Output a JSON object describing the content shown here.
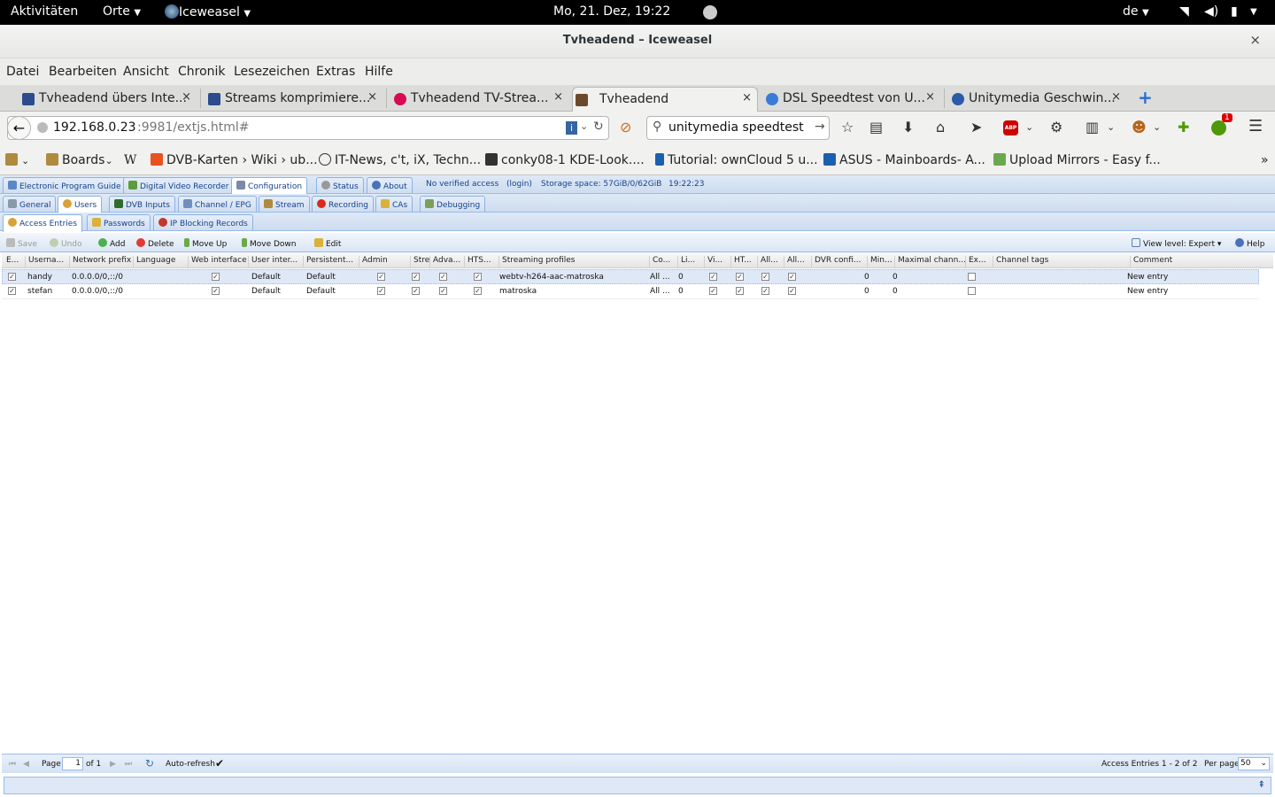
{
  "topbar": {
    "activities": "Aktivitäten",
    "places": "Orte",
    "app": "Iceweasel",
    "clock": "Mo, 21. Dez, 19:22",
    "lang": "de"
  },
  "window": {
    "title": "Tvheadend – Iceweasel",
    "close": "×"
  },
  "menu": [
    "Datei",
    "Bearbeiten",
    "Ansicht",
    "Chronik",
    "Lesezeichen",
    "Extras",
    "Hilfe"
  ],
  "tabs": [
    {
      "label": "Tvheadend übers Inte...",
      "color": "#2b4b8c"
    },
    {
      "label": "Streams komprimiere...",
      "color": "#2b4b8c"
    },
    {
      "label": "Tvheadend TV-Strea...",
      "color": "#d70a53"
    },
    {
      "label": "Tvheadend",
      "color": "#6b4a2b"
    },
    {
      "label": "DSL Speedtest von U...",
      "color": "#3a7bd5"
    },
    {
      "label": "Unitymedia Geschwin...",
      "color": "#2a5aa8"
    }
  ],
  "tab_close": "×",
  "newtab": "+",
  "url": {
    "host": "192.168.0.23",
    "rest": ":9981/extjs.html#"
  },
  "search": {
    "value": "unitymedia speedtest"
  },
  "badge": "1",
  "bookmarks": [
    {
      "label": "",
      "color": "#b08a3e"
    },
    {
      "label": "Boards",
      "color": "#b08a3e"
    },
    {
      "label": "W",
      "color": "#ffffff"
    },
    {
      "label": "DVB-Karten › Wiki › ub...",
      "color": "#e8531f"
    },
    {
      "label": "IT-News, c't, iX, Techn...",
      "color": "#ffffff"
    },
    {
      "label": "conky08-1 KDE-Look....",
      "color": "#333333"
    },
    {
      "label": "Tutorial: ownCloud 5 u...",
      "color": "#1d5fae"
    },
    {
      "label": "ASUS - Mainboards- A...",
      "color": "#1c5eb0"
    },
    {
      "label": "Upload Mirrors - Easy f...",
      "color": "#6aa84f"
    }
  ],
  "bm_more": "»",
  "tvh": {
    "main_tabs": [
      "Electronic Program Guide",
      "Digital Video Recorder",
      "Configuration",
      "Status",
      "About"
    ],
    "status": {
      "access": "No verified access",
      "login": "(login)",
      "storage": "Storage space: 57GiB/0/62GiB",
      "time": "19:22:23"
    },
    "config_tabs": [
      "General",
      "Users",
      "DVB Inputs",
      "Channel / EPG",
      "Stream",
      "Recording",
      "CAs",
      "Debugging"
    ],
    "user_tabs": [
      "Access Entries",
      "Passwords",
      "IP Blocking Records"
    ],
    "toolbar": {
      "save": "Save",
      "undo": "Undo",
      "add": "Add",
      "delete": "Delete",
      "moveup": "Move Up",
      "movedown": "Move Down",
      "edit": "Edit",
      "viewlevel": "View level: Expert",
      "help": "Help"
    },
    "columns": [
      "E...",
      "Userna...",
      "Network prefix",
      "Language",
      "Web interface",
      "User inter...",
      "Persistent...",
      "Admin",
      "Stre",
      "Adva...",
      "HTS...",
      "Streaming profiles",
      "Co...",
      "Li...",
      "Vi...",
      "HT...",
      "All...",
      "All...",
      "DVR confi...",
      "Min...",
      "Maximal chann...",
      "Ex...",
      "Channel tags",
      "Comment"
    ],
    "rows": [
      {
        "user": "handy",
        "prefix": "0.0.0.0/0,::/0",
        "ui": "Default",
        "persist": "Default",
        "profiles": "webtv-h264-aac-matroska",
        "co": "All ...",
        "li": "0",
        "min": "0",
        "max": "0",
        "comment": "New entry"
      },
      {
        "user": "stefan",
        "prefix": "0.0.0.0/0,::/0",
        "ui": "Default",
        "persist": "Default",
        "profiles": "matroska",
        "co": "All ...",
        "li": "0",
        "min": "0",
        "max": "0",
        "comment": "New entry"
      }
    ],
    "pager": {
      "page_label": "Page",
      "page": "1",
      "of": "of 1",
      "autorefresh": "Auto-refresh",
      "summary": "Access Entries 1 - 2 of 2",
      "perpage_label": "Per page",
      "perpage": "50"
    }
  },
  "colors": {
    "accent": "#15428b",
    "border": "#99bbe8",
    "selected_row": "#dfe8f6"
  }
}
